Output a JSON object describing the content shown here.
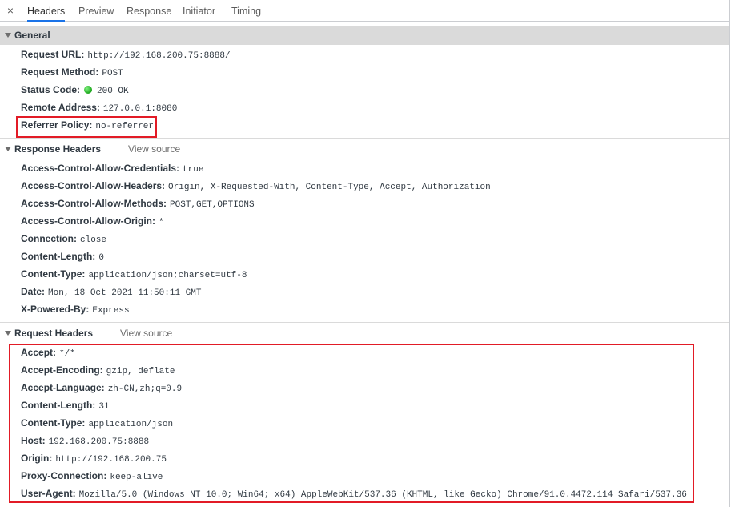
{
  "tabs": [
    "Headers",
    "Preview",
    "Response",
    "Initiator",
    "Timing"
  ],
  "close_glyph": "×",
  "general": {
    "title": "General",
    "rows": [
      {
        "key": "Request URL:",
        "value": "http://192.168.200.75:8888/"
      },
      {
        "key": "Request Method:",
        "value": "POST"
      },
      {
        "key": "Status Code:",
        "value": "200 OK"
      },
      {
        "key": "Remote Address:",
        "value": "127.0.0.1:8080"
      },
      {
        "key": "Referrer Policy:",
        "value": "no-referrer"
      }
    ]
  },
  "response_headers": {
    "title": "Response Headers",
    "view_source": "View source",
    "rows": [
      {
        "key": "Access-Control-Allow-Credentials:",
        "value": "true"
      },
      {
        "key": "Access-Control-Allow-Headers:",
        "value": "Origin, X-Requested-With, Content-Type, Accept, Authorization"
      },
      {
        "key": "Access-Control-Allow-Methods:",
        "value": "POST,GET,OPTIONS"
      },
      {
        "key": "Access-Control-Allow-Origin:",
        "value": "*"
      },
      {
        "key": "Connection:",
        "value": "close"
      },
      {
        "key": "Content-Length:",
        "value": "0"
      },
      {
        "key": "Content-Type:",
        "value": "application/json;charset=utf-8"
      },
      {
        "key": "Date:",
        "value": "Mon, 18 Oct 2021 11:50:11 GMT"
      },
      {
        "key": "X-Powered-By:",
        "value": "Express"
      }
    ]
  },
  "request_headers": {
    "title": "Request Headers",
    "view_source": "View source",
    "rows": [
      {
        "key": "Accept:",
        "value": "*/*"
      },
      {
        "key": "Accept-Encoding:",
        "value": "gzip, deflate"
      },
      {
        "key": "Accept-Language:",
        "value": "zh-CN,zh;q=0.9"
      },
      {
        "key": "Content-Length:",
        "value": "31"
      },
      {
        "key": "Content-Type:",
        "value": "application/json"
      },
      {
        "key": "Host:",
        "value": "192.168.200.75:8888"
      },
      {
        "key": "Origin:",
        "value": "http://192.168.200.75"
      },
      {
        "key": "Proxy-Connection:",
        "value": "keep-alive"
      },
      {
        "key": "User-Agent:",
        "value": "Mozilla/5.0 (Windows NT 10.0; Win64; x64) AppleWebKit/537.36 (KHTML, like Gecko) Chrome/91.0.4472.114 Safari/537.36"
      }
    ]
  },
  "colors": {
    "accent": "#1a73e8",
    "highlight": "#e21b26",
    "status_ok": "#1aa51a"
  }
}
